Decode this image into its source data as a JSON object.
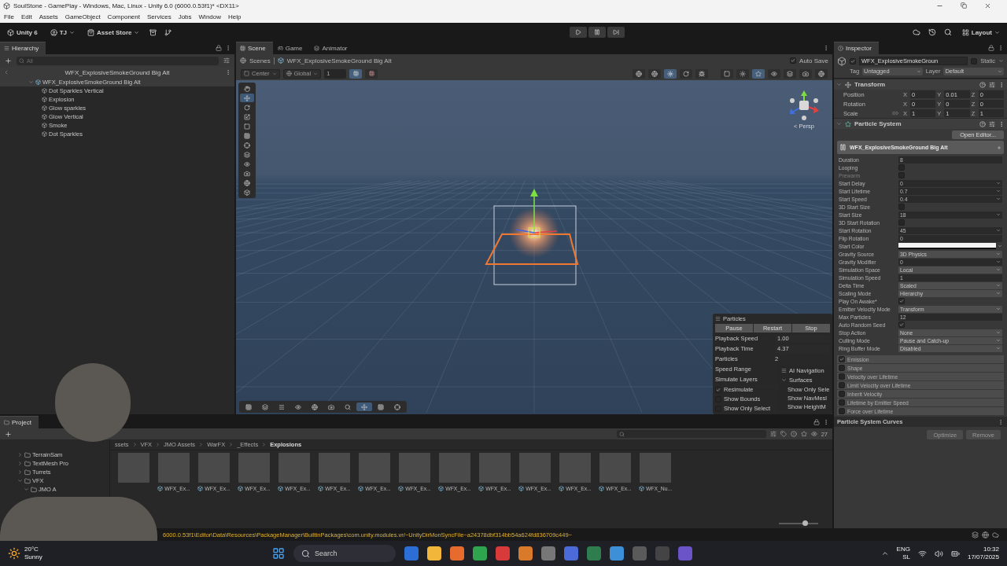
{
  "window": {
    "title": "SoulStone - GamePlay - Windows, Mac, Linux - Unity 6.0 (6000.0.53f1)* <DX11>"
  },
  "menu": [
    "File",
    "Edit",
    "Assets",
    "GameObject",
    "Component",
    "Services",
    "Jobs",
    "Window",
    "Help"
  ],
  "toolbar": {
    "product": "Unity 6",
    "account": "TJ",
    "store": "Asset Store",
    "layout": "Layout"
  },
  "hierarchy": {
    "title": "Hierarchy",
    "search_placeholder": "All",
    "prefab_header": "WFX_ExplosiveSmokeGround Big Alt",
    "tree": [
      {
        "label": "WFX_ExplosiveSmokeGround Big Alt",
        "selected": true,
        "expanded": true,
        "children": [
          {
            "label": "Dot Sparkles Vertical",
            "selected": false
          },
          {
            "label": "Explosion",
            "selected": false
          },
          {
            "label": "Glow sparkles",
            "selected": false
          },
          {
            "label": "Glow Vertical",
            "selected": false
          },
          {
            "label": "Smoke",
            "selected": false
          },
          {
            "label": "Dot Sparkles",
            "selected": false
          }
        ]
      }
    ]
  },
  "scene": {
    "tabs": [
      {
        "label": "Scene",
        "selected": true
      },
      {
        "label": "Game",
        "selected": false
      },
      {
        "label": "Animator",
        "selected": false
      }
    ],
    "breadcrumbs": [
      "Scenes",
      "WFX_ExplosiveSmokeGround Big Alt"
    ],
    "auto_save": {
      "label": "Auto Save",
      "checked": true
    },
    "pivot": "Center",
    "space": "Global",
    "grid_size": "1",
    "view_label": "< Persp",
    "particles_overlay": {
      "title": "Particles",
      "buttons": [
        "Pause",
        "Restart",
        "Stop"
      ],
      "fields": [
        {
          "label": "Playback Speed",
          "value": "1.00",
          "kind": "field"
        },
        {
          "label": "Playback Time",
          "value": "4.37",
          "kind": "field"
        },
        {
          "label": "Particles",
          "value": "2",
          "kind": "text"
        },
        {
          "label": "Speed Range",
          "kind": "covered"
        },
        {
          "label": "Simulate Layers",
          "kind": "covered"
        }
      ],
      "toggles": [
        {
          "label": "Resimulate",
          "checked": true
        },
        {
          "label": "Show Bounds",
          "checked": false
        },
        {
          "label": "Show Only Select",
          "checked": false
        }
      ]
    },
    "navigation_overlay": {
      "title": "AI Navigation",
      "section": "Surfaces",
      "expanded": true,
      "items": [
        "Show Only Sele",
        "Show NavMesl",
        "Show HeightM"
      ]
    }
  },
  "inspector": {
    "title": "Inspector",
    "object": {
      "name": "WFX_ExplosiveSmokeGroun",
      "active": true,
      "static_label": "Static",
      "static": false,
      "tag_label": "Tag",
      "tag": "Untagged",
      "layer_label": "Layer",
      "layer": "Default"
    },
    "transform": {
      "title": "Transform",
      "expanded": true,
      "rows": [
        {
          "label": "Position",
          "values": [
            {
              "axis": "X",
              "value": "0"
            },
            {
              "axis": "Y",
              "value": "0.01"
            },
            {
              "axis": "Z",
              "value": "0"
            }
          ]
        },
        {
          "label": "Rotation",
          "values": [
            {
              "axis": "X",
              "value": "0"
            },
            {
              "axis": "Y",
              "value": "0"
            },
            {
              "axis": "Z",
              "value": "0"
            }
          ]
        },
        {
          "label": "Scale",
          "linked": false,
          "values": [
            {
              "axis": "X",
              "value": "1"
            },
            {
              "axis": "Y",
              "value": "1"
            },
            {
              "axis": "Z",
              "value": "1"
            }
          ]
        }
      ]
    },
    "particle_system": {
      "title": "Particle System",
      "expanded": true,
      "open_editor": "Open Editor...",
      "module_title": "WFX_ExplosiveSmokeGround Big Alt",
      "properties": [
        {
          "label": "Duration",
          "kind": "field",
          "value": "8",
          "disabled": false
        },
        {
          "label": "Looping",
          "kind": "checkbox",
          "checked": false,
          "disabled": false
        },
        {
          "label": "Prewarm",
          "kind": "checkbox",
          "checked": false,
          "disabled": true
        },
        {
          "label": "Start Delay",
          "kind": "curve",
          "value": "0",
          "disabled": false
        },
        {
          "label": "Start Lifetime",
          "kind": "curve",
          "value": "0.7",
          "disabled": false
        },
        {
          "label": "Start Speed",
          "kind": "curve",
          "value": "0.4",
          "disabled": false
        },
        {
          "label": "3D Start Size",
          "kind": "checkbox",
          "checked": false,
          "disabled": false
        },
        {
          "label": "Start Size",
          "kind": "curve",
          "value": "18",
          "disabled": false
        },
        {
          "label": "3D Start Rotation",
          "kind": "checkbox",
          "checked": false,
          "disabled": false
        },
        {
          "label": "Start Rotation",
          "kind": "curve",
          "value": "45",
          "disabled": false
        },
        {
          "label": "Flip Rotation",
          "kind": "field",
          "value": "0",
          "disabled": false
        },
        {
          "label": "Start Color",
          "kind": "color",
          "disabled": false
        },
        {
          "label": "Gravity Source",
          "kind": "dropdown",
          "value": "3D Physics",
          "disabled": false
        },
        {
          "label": "Gravity Modifier",
          "kind": "curve",
          "value": "0",
          "disabled": false
        },
        {
          "label": "Simulation Space",
          "kind": "dropdown",
          "value": "Local",
          "disabled": false
        },
        {
          "label": "Simulation Speed",
          "kind": "field",
          "value": "1",
          "disabled": false
        },
        {
          "label": "Delta Time",
          "kind": "dropdown",
          "value": "Scaled",
          "disabled": false
        },
        {
          "label": "Scaling Mode",
          "kind": "dropdown",
          "value": "Hierarchy",
          "disabled": false
        },
        {
          "label": "Play On Awake*",
          "kind": "checkbox",
          "checked": true,
          "disabled": false
        },
        {
          "label": "Emitter Velocity Mode",
          "kind": "dropdown",
          "value": "Transform",
          "disabled": false
        },
        {
          "label": "Max Particles",
          "kind": "field",
          "value": "12",
          "disabled": false
        },
        {
          "label": "Auto Random Seed",
          "kind": "checkbox",
          "checked": true,
          "disabled": false
        },
        {
          "label": "Stop Action",
          "kind": "dropdown",
          "value": "None",
          "disabled": false
        },
        {
          "label": "Culling Mode",
          "kind": "dropdown",
          "value": "Pause and Catch-up",
          "disabled": false
        },
        {
          "label": "Ring Buffer Mode",
          "kind": "dropdown",
          "value": "Disabled",
          "disabled": false
        }
      ],
      "modules": [
        {
          "label": "Emission",
          "checked": true
        },
        {
          "label": "Shape",
          "checked": false
        },
        {
          "label": "Velocity over Lifetime",
          "checked": false
        },
        {
          "label": "Limit Velocity over Lifetime",
          "checked": false
        },
        {
          "label": "Inherit Velocity",
          "checked": false
        },
        {
          "label": "Lifetime by Emitter Speed",
          "checked": false
        },
        {
          "label": "Force over Lifetime",
          "checked": false
        }
      ]
    },
    "curves": {
      "title": "Particle System Curves",
      "buttons": [
        {
          "label": "Optimize",
          "disabled": true
        },
        {
          "label": "Remove",
          "disabled": true
        }
      ]
    }
  },
  "project": {
    "tabs": [
      {
        "label": "Project",
        "selected": true
      }
    ],
    "count": "27",
    "breadcrumbs": [
      "ssets",
      "VFX",
      "JMO Assets",
      "WarFX",
      "_Effects",
      "Explosions"
    ],
    "tree": [
      {
        "label": "TerrainSam",
        "expanded": false
      },
      {
        "label": "TextMesh Pro",
        "expanded": false
      },
      {
        "label": "Turrets",
        "expanded": false
      },
      {
        "label": "VFX",
        "expanded": true,
        "children": [
          {
            "label": "JMO A",
            "expanded": true
          }
        ]
      }
    ],
    "assets": [
      {
        "kind": "covered"
      },
      {
        "kind": "prefab",
        "label": "WFX_Ex..."
      },
      {
        "kind": "prefab",
        "label": "WFX_Ex..."
      },
      {
        "kind": "prefab",
        "label": "WFX_Ex..."
      },
      {
        "kind": "prefab",
        "label": "WFX_Ex..."
      },
      {
        "kind": "prefab",
        "label": "WFX_Ex..."
      },
      {
        "kind": "prefab",
        "label": "WFX_Ex..."
      },
      {
        "kind": "prefab",
        "label": "WFX_Ex..."
      },
      {
        "kind": "prefab",
        "label": "WFX_Ex..."
      },
      {
        "kind": "prefab",
        "label": "WFX_Ex..."
      },
      {
        "kind": "prefab",
        "label": "WFX_Ex..."
      },
      {
        "kind": "prefab",
        "label": "WFX_Ex..."
      },
      {
        "kind": "prefab",
        "label": "WFX_Ex..."
      },
      {
        "kind": "prefab",
        "label": "WFX_Nu..."
      }
    ],
    "thumbnail_size": {
      "level": 0.65
    }
  },
  "status_bar": {
    "message": "6000.0.53f1\\Editor\\Data\\Resources\\PackageManager\\BuiltinPackages\\com.unity.modules.vr/~UnityDirMonSyncFile~a24378dbf314bb54a624fd836709c449~"
  },
  "taskbar": {
    "weather": {
      "temperature": "20°C",
      "condition": "Sunny"
    },
    "search_placeholder": "Search",
    "language": [
      "ENG",
      "SL"
    ],
    "time": "10:32",
    "date": "17/07/2025"
  }
}
